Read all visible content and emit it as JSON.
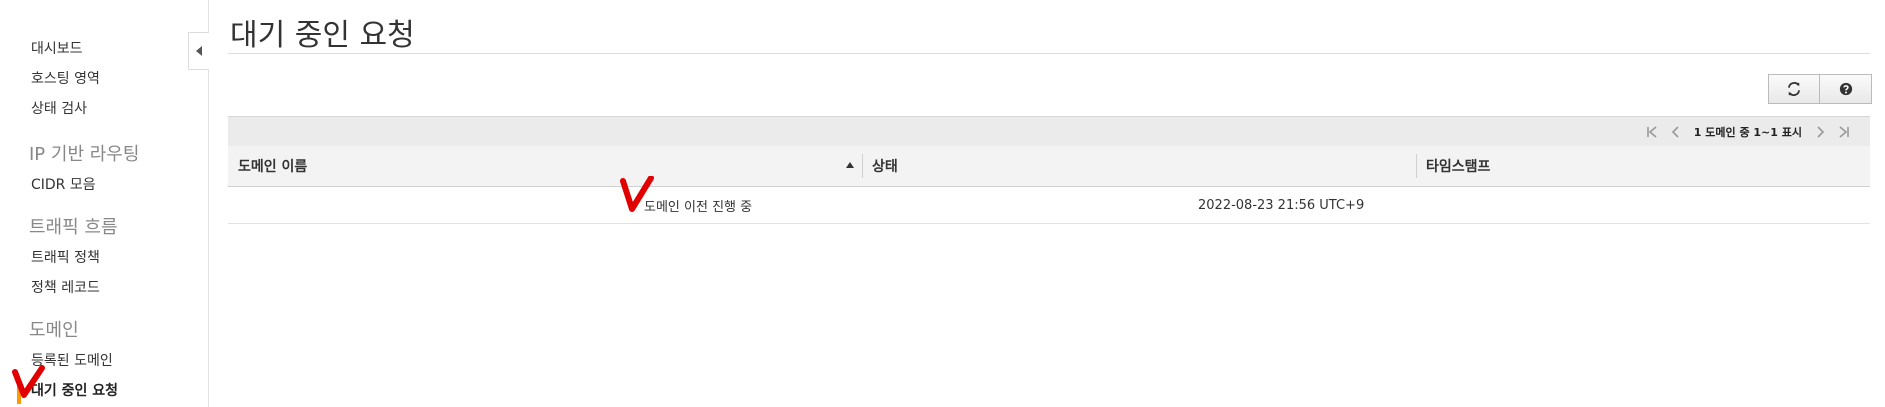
{
  "sidebar": {
    "items": [
      {
        "label": "대시보드"
      },
      {
        "label": "호스팅 영역"
      },
      {
        "label": "상태 검사"
      }
    ],
    "section_ip": "IP 기반 라우팅",
    "ip_items": [
      {
        "label": "CIDR 모음"
      }
    ],
    "section_traffic": "트래픽 흐름",
    "traffic_items": [
      {
        "label": "트래픽 정책"
      },
      {
        "label": "정책 레코드"
      }
    ],
    "section_domain": "도메인",
    "domain_items": [
      {
        "label": "등록된 도메인"
      },
      {
        "label": "대기 중인 요청"
      }
    ],
    "active_item": "대기 중인 요청"
  },
  "page": {
    "title": "대기 중인 요청"
  },
  "toolbar": {
    "refresh_icon": "refresh-icon",
    "help_icon": "help-icon"
  },
  "pager": {
    "text": "1 도메인 중 1~1 표시"
  },
  "table": {
    "columns": [
      "도메인 이름",
      "상태",
      "타임스탬프"
    ],
    "sorted_column": "도메인 이름",
    "rows": [
      {
        "domain": "",
        "status": "도메인 이전 진행 중",
        "timestamp": "2022-08-23 21:56 UTC+9"
      }
    ]
  },
  "colors": {
    "accent_active": "#ff9900",
    "annotation": "#e00000"
  }
}
